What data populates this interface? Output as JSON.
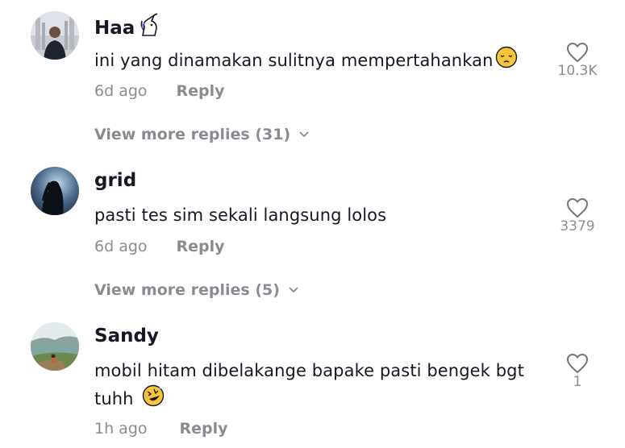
{
  "comments": [
    {
      "username": "Haa",
      "username_emoji": "unicorn-icon",
      "text": "ini yang dinamakan sulitnya mempertahankan",
      "text_emoji": "pensive-face-icon",
      "time": "6d ago",
      "reply_label": "Reply",
      "like_count": "10.3K",
      "view_more_label": "View more replies (31)"
    },
    {
      "username": "grid",
      "text": "pasti tes sim sekali langsung lolos",
      "time": "6d ago",
      "reply_label": "Reply",
      "like_count": "3379",
      "view_more_label": "View more replies (5)"
    },
    {
      "username": "Sandy",
      "text": "mobil hitam dibelakange bapake pasti bengek bgt tuhh",
      "text_emoji": "rolling-on-floor-laughing-icon",
      "time": "1h ago",
      "reply_label": "Reply",
      "like_count": "1"
    }
  ],
  "colors": {
    "text": "#161823",
    "muted": "rgba(22,24,35,0.5)",
    "emoji_yellow": "#f7c538"
  }
}
